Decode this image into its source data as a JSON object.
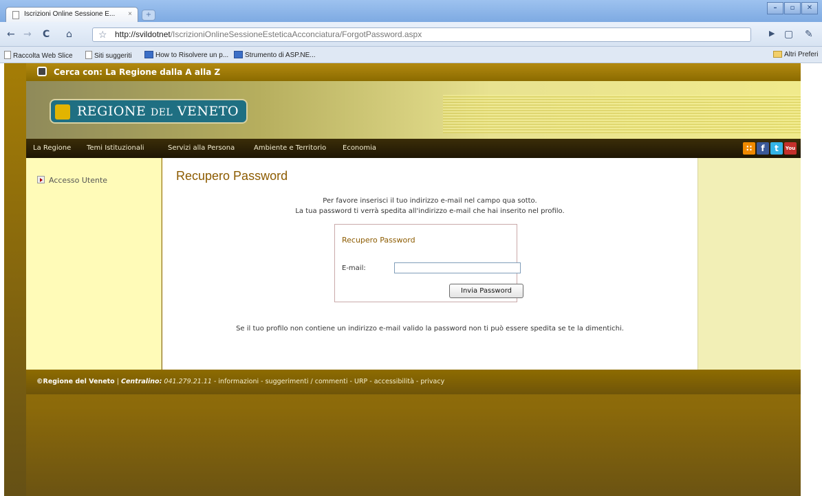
{
  "browser": {
    "tab_title": "Iscrizioni Online Sessione E...",
    "tab_close": "×",
    "new_tab": "+",
    "url_host": "http://svildotnet",
    "url_path": "/IscrizioniOnlineSessioneEsteticaAcconciatura/ForgotPassword.aspx",
    "bookmarks": [
      "Raccolta Web Slice",
      "Siti suggeriti",
      "How to Risolvere un p...",
      "Strumento di ASP.NE..."
    ],
    "other_bookmarks": "Altri Preferi",
    "window_buttons": [
      "–",
      "▫",
      "✕"
    ]
  },
  "site": {
    "search_text": "Cerca con: La Regione dalla A alla Z",
    "logo_word1": "REGIONE",
    "logo_word2": "DEL",
    "logo_word3": "VENETO",
    "menu": [
      "La Regione",
      "Temi Istituzionali",
      "Servizi alla Persona",
      "Ambiente e Territorio",
      "Economia"
    ],
    "social": {
      "rss": "∷",
      "facebook": "f",
      "twitter": "t",
      "youtube": "You"
    },
    "left_link": "Accesso Utente"
  },
  "content": {
    "heading": "Recupero Password",
    "intro_line1": "Per favore inserisci il tuo indirizzo e-mail nel campo qua sotto.",
    "intro_line2": "La tua password ti verrà spedita all'indirizzo e-mail che hai inserito nel profilo.",
    "box_title": "Recupero Password",
    "email_label": "E-mail:",
    "email_value": "",
    "submit_label": "Invia Password",
    "note": "Se il tuo profilo non contiene un indirizzo e-mail valido la password non ti può essere spedita se te la dimentichi."
  },
  "footer": {
    "copyright": "©Regione del Veneto",
    "sep": " | ",
    "centralino_label": "Centralino:",
    "centralino_number": "041.279.21.11",
    "links": " - informazioni - suggerimenti / commenti - URP - accessibilità - privacy"
  }
}
